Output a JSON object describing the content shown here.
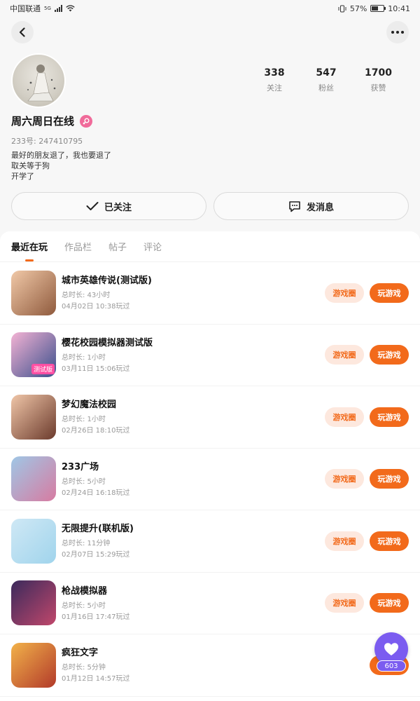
{
  "status_bar": {
    "carrier": "中国联通",
    "network": "5G",
    "battery": "57%",
    "time": "10:41"
  },
  "profile": {
    "name": "周六周日在线",
    "uid": "233号: 247410795",
    "bio": [
      "最好的朋友退了，我也要退了",
      "取关等于狗",
      "开学了"
    ],
    "stats": [
      {
        "num": "338",
        "label": "关注"
      },
      {
        "num": "547",
        "label": "粉丝"
      },
      {
        "num": "1700",
        "label": "获赞"
      }
    ],
    "follow_label": "已关注",
    "message_label": "发消息"
  },
  "tabs": [
    "最近在玩",
    "作品栏",
    "帖子",
    "评论"
  ],
  "active_tab": 0,
  "game_actions": {
    "circle_label": "游戏圈",
    "play_label": "玩游戏"
  },
  "games": [
    {
      "title": "城市英雄传说(测试版)",
      "duration": "总时长: 43小时",
      "last_played": "04月02日 10:38玩过",
      "colors": [
        "#f1c9a8",
        "#8f5a3d"
      ]
    },
    {
      "title": "樱花校园模拟器测试版",
      "duration": "总时长: 1小时",
      "last_played": "03月11日 15:06玩过",
      "colors": [
        "#f4b3d4",
        "#3a4f8c"
      ],
      "badge": "测试版"
    },
    {
      "title": "梦幻魔法校园",
      "duration": "总时长: 1小时",
      "last_played": "02月26日 18:10玩过",
      "colors": [
        "#f0c6a8",
        "#6b3a2c"
      ]
    },
    {
      "title": "233广场",
      "duration": "总时长: 5小时",
      "last_played": "02月24日 16:18玩过",
      "colors": [
        "#9fc7e6",
        "#d77ba1"
      ]
    },
    {
      "title": "无限提升(联机版)",
      "duration": "总时长: 11分钟",
      "last_played": "02月07日 15:29玩过",
      "colors": [
        "#cfe8f5",
        "#a0d4ec"
      ]
    },
    {
      "title": "枪战模拟器",
      "duration": "总时长: 5小时",
      "last_played": "01月16日 17:47玩过",
      "colors": [
        "#3b2a5c",
        "#c0476b"
      ]
    },
    {
      "title": "疯狂文字",
      "duration": "总时长: 5分钟",
      "last_played": "01月12日 14:57玩过",
      "colors": [
        "#f2b24a",
        "#b23a2a"
      ]
    }
  ],
  "fab": {
    "count": "603"
  }
}
